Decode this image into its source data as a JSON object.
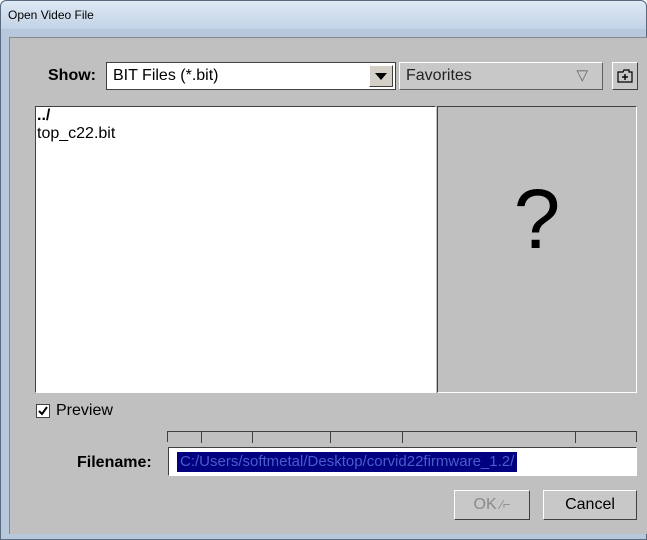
{
  "window": {
    "title": "Open Video File"
  },
  "show": {
    "label": "Show:",
    "selected": "BIT Files (*.bit)"
  },
  "favorites": {
    "label": "Favorites",
    "icon": "triangle-down-outline-icon"
  },
  "new_folder_button": {
    "icon": "new-folder-icon"
  },
  "file_list": {
    "items": [
      {
        "name": "../",
        "bold": true
      },
      {
        "name": "top_c22.bit",
        "bold": false
      }
    ]
  },
  "preview_pane": {
    "glyph": "?"
  },
  "preview_option": {
    "label": "Preview",
    "checked": true
  },
  "filename": {
    "label": "Filename:",
    "value": "C:/Users/softmetal/Desktop/corvid22firmware_1.2/"
  },
  "buttons": {
    "ok_label": "OK",
    "ok_icon": "shortcut-arrow-icon",
    "ok_enabled": false,
    "cancel_label": "Cancel"
  },
  "colors": {
    "selection_bg": "#000080",
    "dialog_bg": "#c0c0c0"
  }
}
